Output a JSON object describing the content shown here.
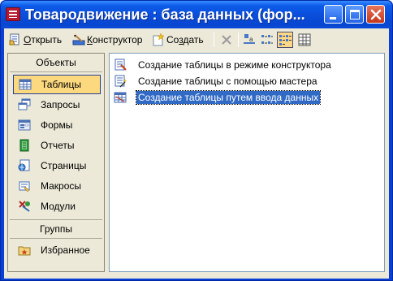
{
  "window": {
    "title": "Товародвижение : база данных (фор..."
  },
  "toolbar": {
    "open": {
      "accel": "О",
      "rest": "ткрыть"
    },
    "design": {
      "accel": "К",
      "rest": "онструктор"
    },
    "create": {
      "pre": "Со",
      "accel": "з",
      "rest": "дать"
    }
  },
  "sidebar": {
    "objects_header": "Объекты",
    "items": [
      {
        "label": "Таблицы",
        "icon": "table-icon",
        "selected": true
      },
      {
        "label": "Запросы",
        "icon": "query-icon"
      },
      {
        "label": "Формы",
        "icon": "form-icon"
      },
      {
        "label": "Отчеты",
        "icon": "report-icon"
      },
      {
        "label": "Страницы",
        "icon": "page-icon"
      },
      {
        "label": "Макросы",
        "icon": "macro-icon"
      },
      {
        "label": "Модули",
        "icon": "module-icon"
      }
    ],
    "groups_header": "Группы",
    "groups": [
      {
        "label": "Избранное",
        "icon": "favorites-icon"
      }
    ]
  },
  "list": {
    "items": [
      {
        "label": "Создание таблицы в режиме конструктора",
        "icon": "design-wizard-icon"
      },
      {
        "label": "Создание таблицы с помощью мастера",
        "icon": "wizard-icon"
      },
      {
        "label": "Создание таблицы путем ввода данных",
        "icon": "datasheet-icon",
        "selected": true
      }
    ]
  },
  "colors": {
    "titlebar": "#0a4fdc",
    "selection": "#316ac5",
    "sidebar_selected": "#fcd97f",
    "client_bg": "#ece9d8"
  }
}
